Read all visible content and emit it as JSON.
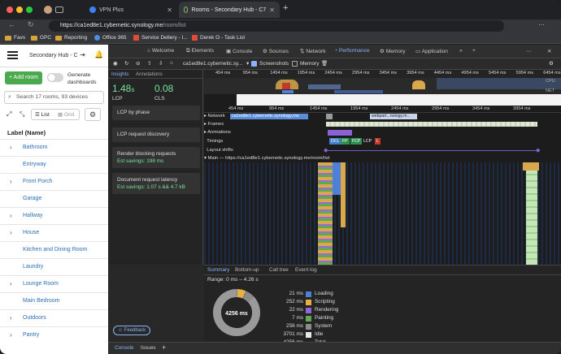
{
  "browser": {
    "tabs": [
      {
        "label": "VPN Plus"
      },
      {
        "label": "Rooms - Secondary Hub - C7"
      }
    ],
    "url_host": "https://ca1ed8e1.cybernetic.synology.me",
    "url_path": "/room/list",
    "bookmarks": [
      "Favs",
      "GPC",
      "Reporting",
      "Office 365",
      "Service Deliery - I...",
      "Derek O - Task List"
    ]
  },
  "app": {
    "header_title": "Secondary Hub - C7",
    "add_room_label": "+ Add room",
    "generate_label_1": "Generate",
    "generate_label_2": "dashboards",
    "search_placeholder": "Search 17 rooms, 93 devices",
    "view_list": "List",
    "view_grid": "Grid",
    "column_header": "Label (Name)",
    "rooms": [
      {
        "label": "Bathroom",
        "expandable": true
      },
      {
        "label": "Entryway",
        "expandable": false
      },
      {
        "label": "Front Porch",
        "expandable": true
      },
      {
        "label": "Garage",
        "expandable": false
      },
      {
        "label": "Hallway",
        "expandable": true
      },
      {
        "label": "House",
        "expandable": true
      },
      {
        "label": "Kitchen and Dining Room",
        "expandable": false
      },
      {
        "label": "Laundry",
        "expandable": false
      },
      {
        "label": "Lounge Room",
        "expandable": true
      },
      {
        "label": "Main Bedroom",
        "expandable": false
      },
      {
        "label": "Outdoors",
        "expandable": true
      },
      {
        "label": "Pantry",
        "expandable": true
      }
    ]
  },
  "devtools": {
    "tabs": [
      "Welcome",
      "Elements",
      "Console",
      "Sources",
      "Network",
      "Performance",
      "Memory",
      "Application"
    ],
    "active_tab": "Performance",
    "recording_host": "ca1ed8e1.cybernetic.sy...",
    "screenshots_label": "Screenshots",
    "memory_label": "Memory",
    "insight_tabs": [
      "Insights",
      "Annotations"
    ],
    "lcp_value": "1.48",
    "lcp_unit": "s",
    "lcp_label": "LCP",
    "cls_value": "0.08",
    "cls_label": "CLS",
    "cards": [
      {
        "title": "LCP by phase",
        "sub": ""
      },
      {
        "title": "LCP request discovery",
        "sub": ""
      },
      {
        "title": "Render blocking requests",
        "sub": "Est savings: 198 ms"
      },
      {
        "title": "Document request latency",
        "sub": "Est savings: 1.07 s && 4.7 kB"
      }
    ],
    "feedback_label": "Feedback",
    "overview_ticks": [
      "454 ms",
      "954 ms",
      "1454 ms",
      "1954 ms",
      "2454 ms",
      "2954 ms",
      "3454 ms",
      "3954 ms",
      "4454 ms",
      "4954 ms",
      "5454 ms",
      "5954 ms",
      "6454 ms"
    ],
    "overview_labels": [
      "CPU",
      "NET"
    ],
    "ruler_ticks": [
      "454 ms",
      "954 ms",
      "1454 ms",
      "1954 ms",
      "2454 ms",
      "2954 ms",
      "3454 ms",
      "3954 ms"
    ],
    "tracks": {
      "network": "Network",
      "network_bar": "ca1ed8e1.cybernetic.synology.me",
      "network_bar2": "webpart...nology.m...",
      "frames": "Frames",
      "animations": "Animations",
      "timings": "Timings",
      "timing_markers": [
        "DCL",
        "FP",
        "FCP",
        "LCP",
        "L"
      ],
      "layout_shifts": "Layout shifts",
      "main": "Main — https://ca1ed8e1.cybernetic.synology.me/room/list"
    },
    "bottom_tabs": [
      "Summary",
      "Bottom-up",
      "Call tree",
      "Event log"
    ],
    "range": "Range: 0 ms – 4.26 s",
    "donut_total": "4256 ms",
    "summary": [
      {
        "value": "21 ms",
        "label": "Loading",
        "color": "#4e7fd9"
      },
      {
        "value": "252 ms",
        "label": "Scripting",
        "color": "#e8b13e"
      },
      {
        "value": "22 ms",
        "label": "Rendering",
        "color": "#9067de"
      },
      {
        "value": "7 ms",
        "label": "Painting",
        "color": "#5fa952"
      },
      {
        "value": "256 ms",
        "label": "System",
        "color": "#8c8c8c"
      },
      {
        "value": "3701 ms",
        "label": "Idle",
        "color": "#e8e8e8"
      },
      {
        "value": "4256 ms",
        "label": "Total",
        "color": ""
      }
    ],
    "footer_tabs": [
      "Console",
      "Issues"
    ]
  }
}
